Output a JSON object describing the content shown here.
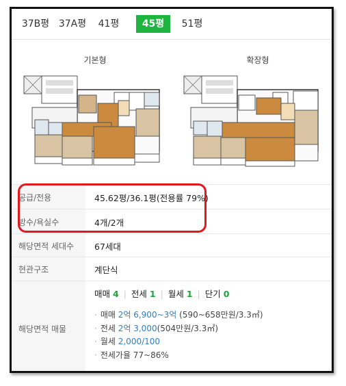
{
  "tabs": [
    {
      "label": "37B평"
    },
    {
      "label": "37A평"
    },
    {
      "label": "41평"
    },
    {
      "label": "45평"
    },
    {
      "label": "51평"
    }
  ],
  "active_tab": "45평",
  "plans": {
    "basic_label": "기본형",
    "extended_label": "확장형"
  },
  "info": {
    "supply": {
      "label": "공급/전용",
      "value": "45.62평/36.1평(전용률 79%)"
    },
    "rooms": {
      "label": "방수/욕실수",
      "value": "4개/2개"
    },
    "households": {
      "label": "해당면적 세대수",
      "value": "67세대"
    },
    "entrance": {
      "label": "현관구조",
      "value": "계단식"
    },
    "listings": {
      "label": "해당면적 매물",
      "counts": {
        "sale_label": "매매",
        "sale_count": "4",
        "jeonse_label": "전세",
        "jeonse_count": "1",
        "monthly_label": "월세",
        "monthly_count": "1",
        "short_label": "단기",
        "short_count": "0"
      },
      "deals": {
        "sale_prefix": "매매 ",
        "sale_price": "2억 6,900~3억",
        "sale_suffix": " (590~658만원/3.3㎡)",
        "jeonse_prefix": "전세 ",
        "jeonse_price": "2억 3,000",
        "jeonse_suffix": "(504만원/3.3㎡)",
        "monthly_prefix": "월세 ",
        "monthly_price": "2,000/100",
        "ratio": "전세가율 77~86%"
      }
    }
  },
  "colors": {
    "accent": "#1fb43f",
    "highlight": "#e3161c",
    "price": "#2e7fc7"
  }
}
